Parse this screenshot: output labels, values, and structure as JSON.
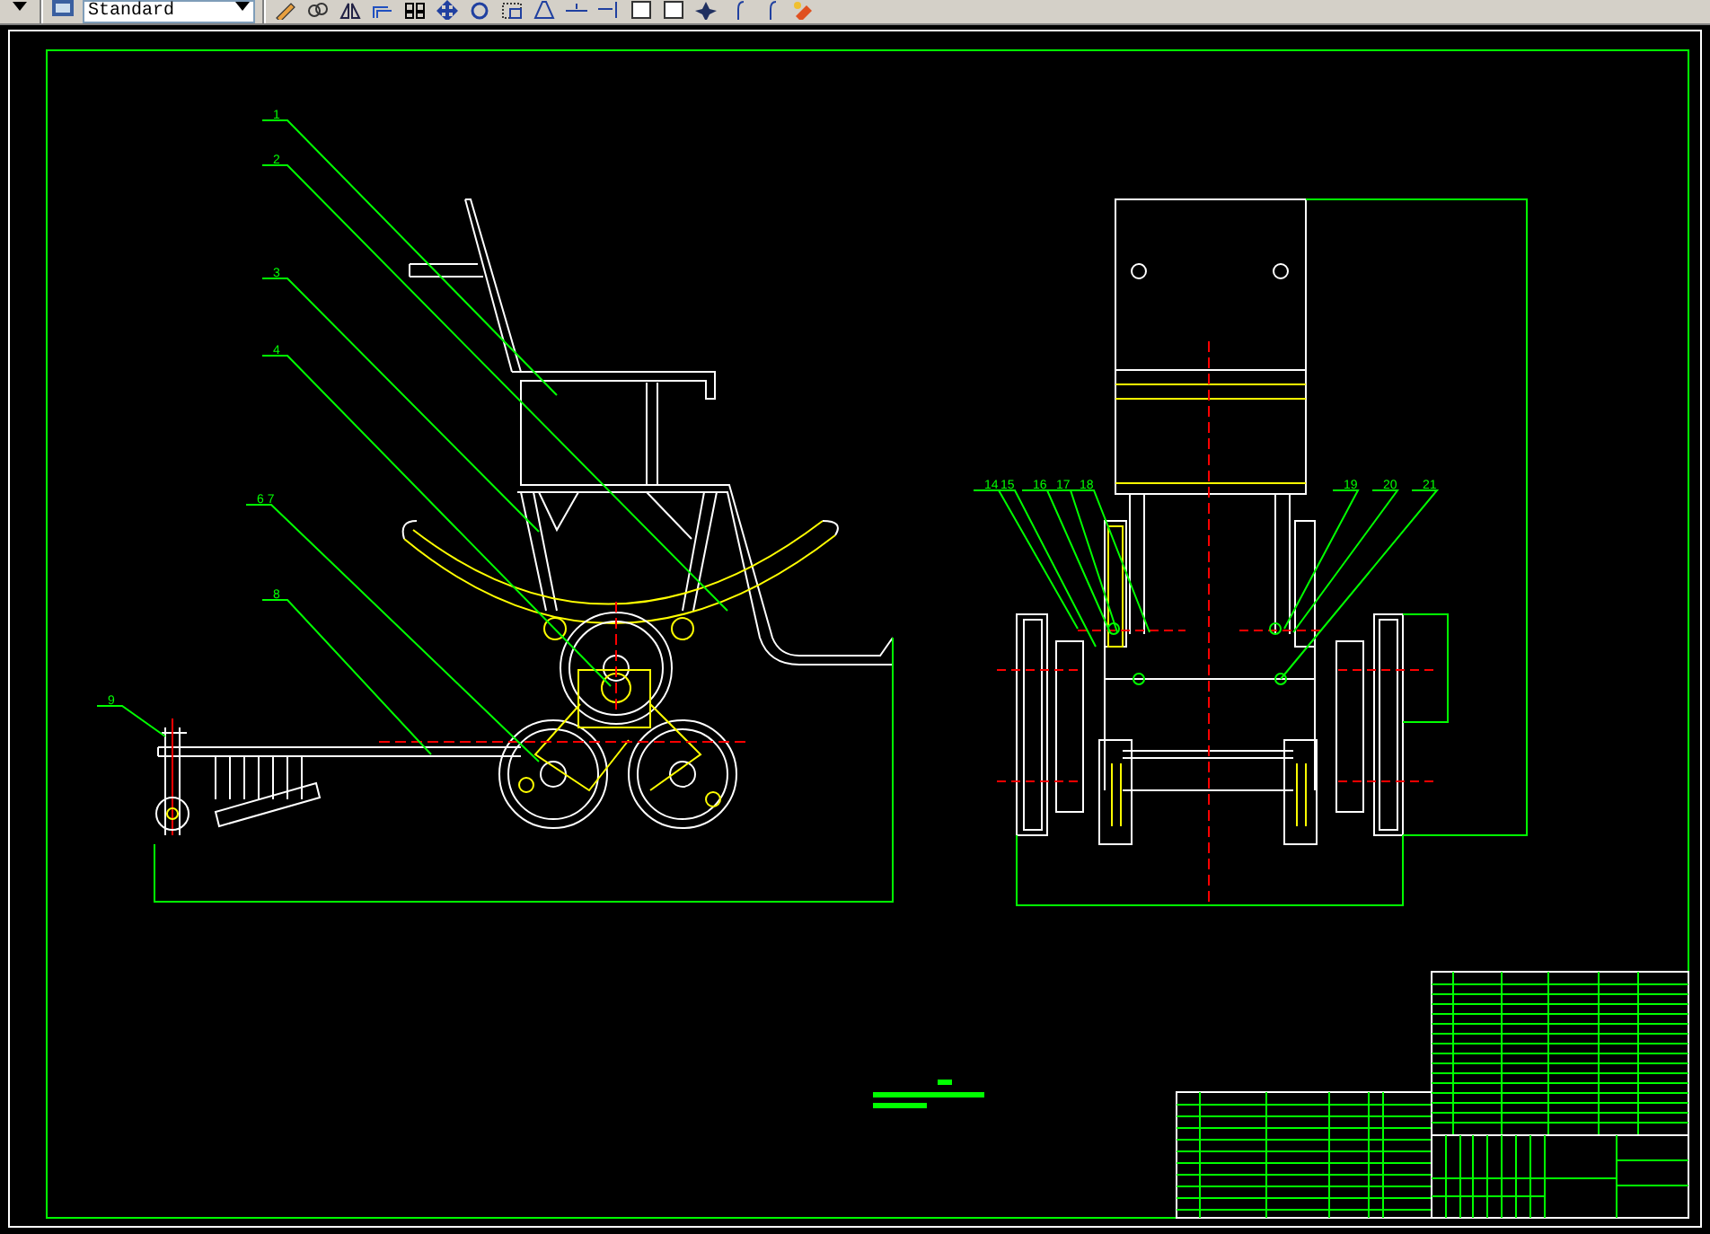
{
  "toolbar": {
    "style_dropdown": "Standard"
  },
  "side_view": {
    "balloons": [
      {
        "label": "1"
      },
      {
        "label": "2"
      },
      {
        "label": "3"
      },
      {
        "label": "4"
      },
      {
        "label": "6 7"
      },
      {
        "label": "8"
      },
      {
        "label": "9"
      }
    ]
  },
  "front_view": {
    "balloons": [
      {
        "label": "14"
      },
      {
        "label": "15"
      },
      {
        "label": "16"
      },
      {
        "label": "17"
      },
      {
        "label": "18"
      },
      {
        "label": "19"
      },
      {
        "label": "20"
      },
      {
        "label": "21"
      }
    ]
  }
}
